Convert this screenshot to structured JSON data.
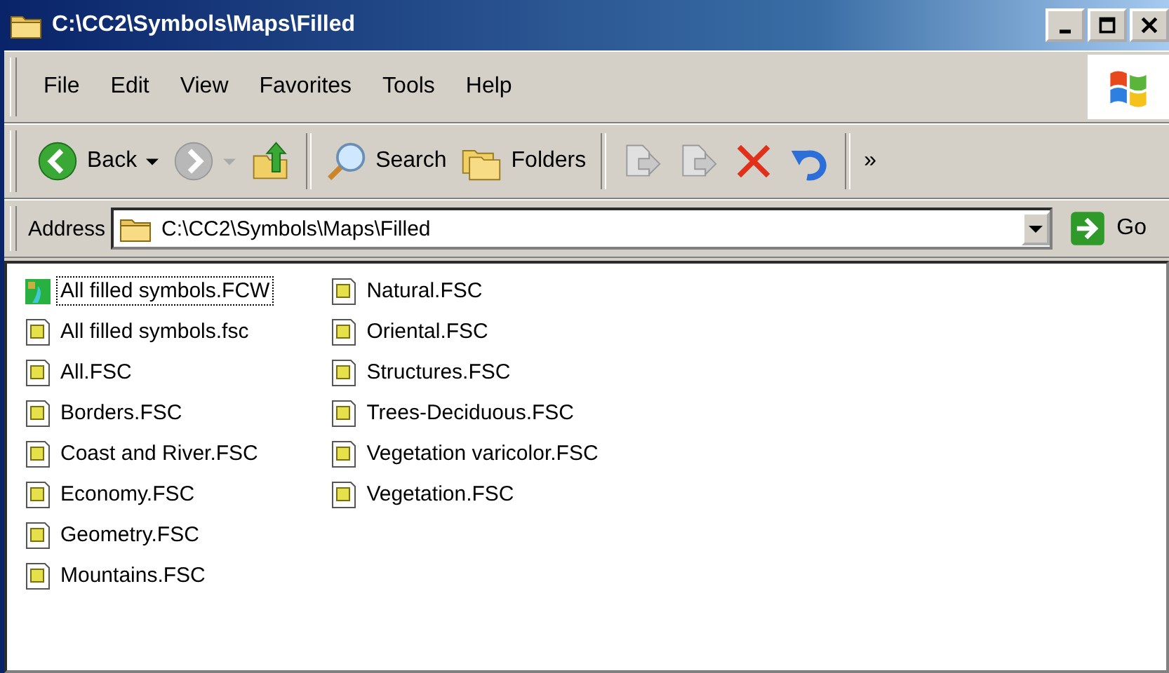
{
  "window": {
    "title": "C:\\CC2\\Symbols\\Maps\\Filled"
  },
  "menu": [
    "File",
    "Edit",
    "View",
    "Favorites",
    "Tools",
    "Help"
  ],
  "toolbar": [
    {
      "kind": "back",
      "label": "Back",
      "disabled": false
    },
    {
      "kind": "forward",
      "disabled": true
    },
    {
      "kind": "up",
      "disabled": false
    },
    {
      "kind": "search",
      "label": "Search",
      "disabled": false
    },
    {
      "kind": "folders",
      "label": "Folders",
      "disabled": false
    },
    {
      "kind": "move",
      "disabled": true
    },
    {
      "kind": "copy",
      "disabled": true
    },
    {
      "kind": "delete",
      "disabled": false
    },
    {
      "kind": "undo",
      "disabled": false
    },
    {
      "kind": "more",
      "label": "»",
      "disabled": false
    }
  ],
  "address": {
    "label": "Address",
    "value": "C:\\CC2\\Symbols\\Maps\\Filled",
    "go": "Go"
  },
  "files": [
    [
      {
        "name": "All filled symbols.FCW",
        "kind": "workspace",
        "focused": true
      },
      {
        "name": "All filled symbols.fsc",
        "kind": "symbols",
        "focused": false
      },
      {
        "name": "All.FSC",
        "kind": "symbols",
        "focused": false
      },
      {
        "name": "Borders.FSC",
        "kind": "symbols",
        "focused": false
      },
      {
        "name": "Coast and River.FSC",
        "kind": "symbols",
        "focused": false
      },
      {
        "name": "Economy.FSC",
        "kind": "symbols",
        "focused": false
      },
      {
        "name": "Geometry.FSC",
        "kind": "symbols",
        "focused": false
      },
      {
        "name": "Mountains.FSC",
        "kind": "symbols",
        "focused": false
      }
    ],
    [
      {
        "name": "Natural.FSC",
        "kind": "symbols",
        "focused": false
      },
      {
        "name": "Oriental.FSC",
        "kind": "symbols",
        "focused": false
      },
      {
        "name": "Structures.FSC",
        "kind": "symbols",
        "focused": false
      },
      {
        "name": "Trees-Deciduous.FSC",
        "kind": "symbols",
        "focused": false
      },
      {
        "name": "Vegetation varicolor.FSC",
        "kind": "symbols",
        "focused": false
      },
      {
        "name": "Vegetation.FSC",
        "kind": "symbols",
        "focused": false
      }
    ]
  ]
}
